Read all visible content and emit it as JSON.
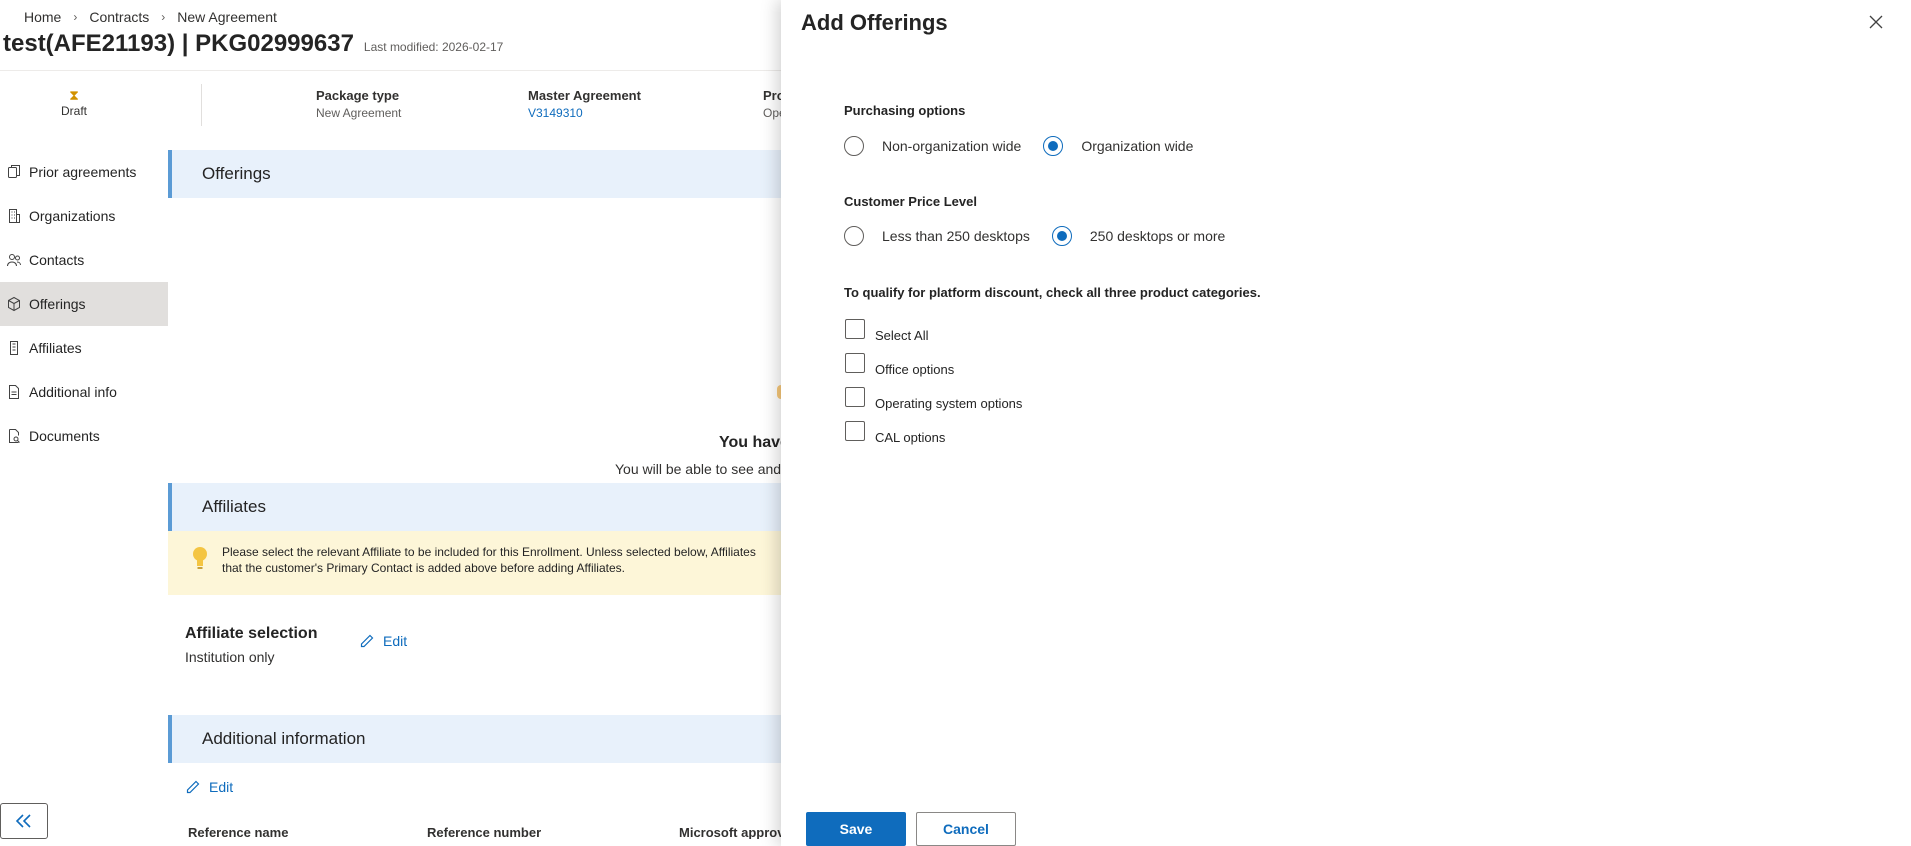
{
  "breadcrumb": [
    "Home",
    "Contracts",
    "New Agreement"
  ],
  "header": {
    "title": "test(AFE21193) | PKG02999637",
    "last_modified": "Last modified: 2026-02-17"
  },
  "summary": {
    "status": "Draft",
    "package_type_label": "Package type",
    "package_type_value": "New Agreement",
    "master_agreement_label": "Master Agreement",
    "master_agreement_value": "V3149310",
    "third_label": "Pro",
    "third_value": "Ope"
  },
  "sidebar": {
    "items": [
      {
        "label": "Prior agreements",
        "icon": "document-copy-icon"
      },
      {
        "label": "Organizations",
        "icon": "building-icon"
      },
      {
        "label": "Contacts",
        "icon": "people-icon"
      },
      {
        "label": "Offerings",
        "icon": "box-icon",
        "active": true
      },
      {
        "label": "Affiliates",
        "icon": "building-small-icon"
      },
      {
        "label": "Additional info",
        "icon": "document-icon"
      },
      {
        "label": "Documents",
        "icon": "document-search-icon"
      }
    ]
  },
  "main": {
    "offerings_header": "Offerings",
    "empty_title": "You have",
    "empty_sub": "You will be able to see and",
    "affiliates_header": "Affiliates",
    "affiliates_notice_line1": "Please select the relevant Affiliate to be included for this Enrollment. Unless selected below, Affiliates",
    "affiliates_notice_line2": "that the customer's Primary Contact is added above before adding Affiliates.",
    "affiliate_selection_label": "Affiliate selection",
    "affiliate_selection_value": "Institution only",
    "edit_label": "Edit",
    "additional_info_header": "Additional information",
    "additional_cols": [
      "Reference name",
      "Reference number",
      "Microsoft approv"
    ]
  },
  "panel": {
    "title": "Add Offerings",
    "purchasing_label": "Purchasing options",
    "purchasing_options": [
      {
        "label": "Non-organization wide",
        "checked": false
      },
      {
        "label": "Organization wide",
        "checked": true
      }
    ],
    "price_level_label": "Customer Price Level",
    "price_level_options": [
      {
        "label": "Less than 250 desktops",
        "checked": false
      },
      {
        "label": "250 desktops or more",
        "checked": true
      }
    ],
    "discount_note": "To qualify for platform discount, check all three product categories.",
    "checkboxes": [
      {
        "label": "Select All",
        "checked": false
      },
      {
        "label": "Office options",
        "checked": false
      },
      {
        "label": "Operating system options",
        "checked": false
      },
      {
        "label": "CAL options",
        "checked": false
      }
    ],
    "save_label": "Save",
    "cancel_label": "Cancel"
  },
  "colors": {
    "accent": "#0f6cbd",
    "section_header_bg": "#e8f1fb",
    "notice_bg": "#fdf6d8",
    "status_hourglass": "#d29200"
  }
}
